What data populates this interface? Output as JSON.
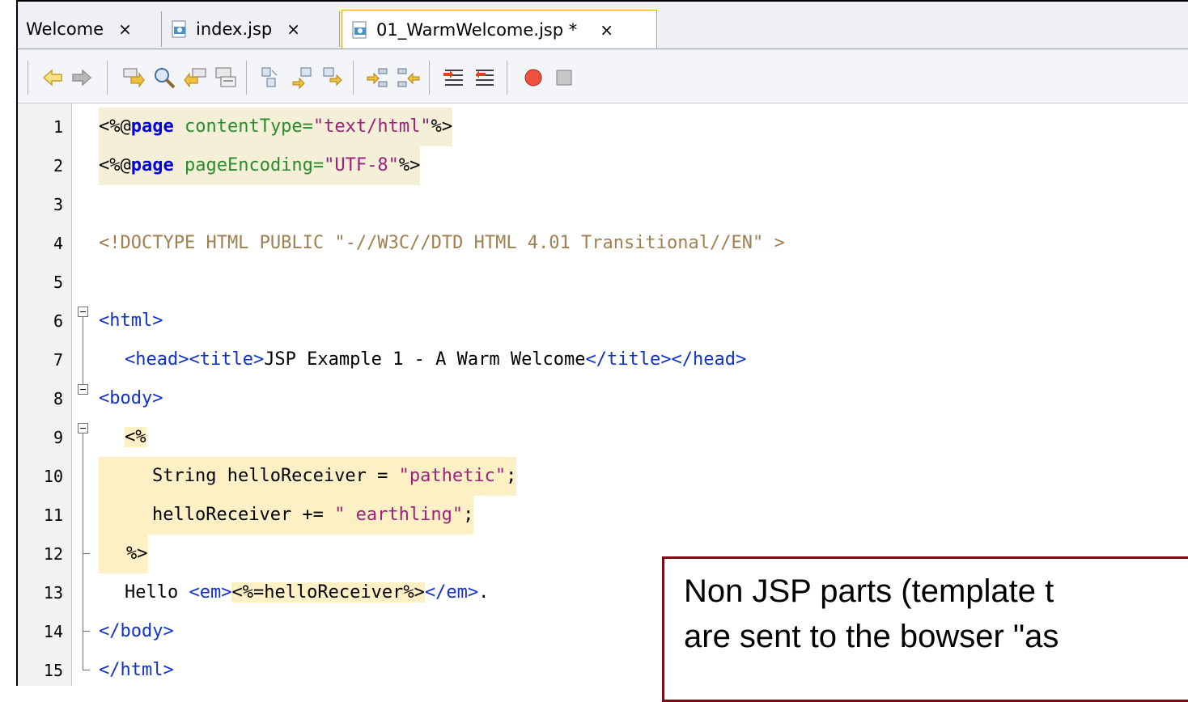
{
  "tabs": [
    {
      "label": "Welcome",
      "close": "×"
    },
    {
      "label": "index.jsp",
      "close": "×"
    },
    {
      "label": "01_WarmWelcome.jsp *",
      "close": "×"
    }
  ],
  "toolbar": {
    "icons": [
      "back-icon",
      "forward-icon",
      "find-next-icon",
      "search-icon",
      "find-prev-icon",
      "toggle-highlight-icon",
      "bookmark-prev-icon",
      "bookmark-next-icon",
      "bookmark-toggle-icon",
      "shift-left-icon",
      "shift-right-icon",
      "comment-icon",
      "uncomment-icon",
      "record-macro-icon",
      "stop-macro-icon"
    ]
  },
  "editor": {
    "lines": [
      {
        "n": "1"
      },
      {
        "n": "2"
      },
      {
        "n": "3"
      },
      {
        "n": "4"
      },
      {
        "n": "5"
      },
      {
        "n": "6"
      },
      {
        "n": "7"
      },
      {
        "n": "8"
      },
      {
        "n": "9"
      },
      {
        "n": "10"
      },
      {
        "n": "11"
      },
      {
        "n": "12"
      },
      {
        "n": "13"
      },
      {
        "n": "14"
      },
      {
        "n": "15"
      }
    ],
    "code": {
      "l1": {
        "open": "<%@",
        "kw": "page",
        "attr": " contentType=",
        "val": "\"text/html\"",
        "close": "%>"
      },
      "l2": {
        "open": "<%@",
        "kw": "page",
        "attr": " pageEncoding=",
        "val": "\"UTF-8\"",
        "close": "%>"
      },
      "l4": "<!DOCTYPE HTML PUBLIC \"-//W3C//DTD HTML 4.01 Transitional//EN\" >",
      "l6": "<html>",
      "l7": {
        "head_open": "<head><title>",
        "title": "JSP Example 1 - A Warm Welcome",
        "head_close": "</title></head>"
      },
      "l8": "<body>",
      "l9": "<%",
      "l10": {
        "code": "String helloReceiver = ",
        "val": "\"pathetic\"",
        "end": ";"
      },
      "l11": {
        "code": "helloReceiver += ",
        "val": "\" earthling\"",
        "end": ";"
      },
      "l12": "%>",
      "l13": {
        "text": "Hello ",
        "em_open": "<em>",
        "expr": "<%=helloReceiver%>",
        "em_close": "</em>",
        "end": "."
      },
      "l14": "</body>",
      "l15": "</html>"
    }
  },
  "callout": {
    "line1": "Non JSP parts (template t",
    "line2": "are sent to the bowser \"as"
  }
}
